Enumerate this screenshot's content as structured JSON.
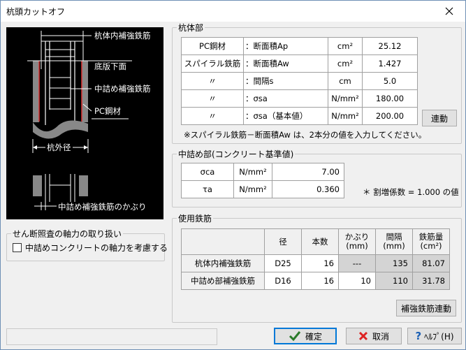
{
  "window": {
    "title": "杭頭カットオフ"
  },
  "diagram": {
    "labels": {
      "pile_inner_rebar": "杭体内補強鉄筋",
      "slab_bottom": "底版下面",
      "filling_rebar": "中詰め補強鉄筋",
      "pc_steel": "PC鋼材",
      "pile_outer_diameter": "杭外径",
      "cover": "中詰め補強鉄筋のかぶり"
    }
  },
  "shear": {
    "legend": "せん断照査の軸力の取り扱い",
    "checkbox_label": "中詰めコンクリートの軸力を考慮する",
    "checked": false
  },
  "pile": {
    "legend": "杭体部",
    "rows": [
      {
        "name": "PC鋼材",
        "item": "：断面積Ap",
        "unit": "cm²",
        "value": "25.12"
      },
      {
        "name": "スパイラル鉄筋",
        "item": "：断面積Aw",
        "unit": "cm²",
        "value": "1.427"
      },
      {
        "name": "〃",
        "item": "：間隔s",
        "unit": "cm",
        "value": "5.0"
      },
      {
        "name": "〃",
        "item": "：σsa",
        "unit": "N/mm²",
        "value": "180.00"
      },
      {
        "name": "〃",
        "item": "：σsa（基本値）",
        "unit": "N/mm²",
        "value": "200.00"
      }
    ],
    "link_button": "連動",
    "note": "※スパイラル鉄筋－断面積Aw は、2本分の値を入力してください。"
  },
  "filling": {
    "legend": "中詰め部(コンクリート基準値)",
    "rows": [
      {
        "name": "σca",
        "unit": "N/mm²",
        "value": "7.00"
      },
      {
        "name": "τa",
        "unit": "N/mm²",
        "value": "0.360"
      }
    ],
    "note": "＊ 割増係数 = 1.000 の値"
  },
  "rebar": {
    "legend": "使用鉄筋",
    "headers": {
      "diameter": "径",
      "count": "本数",
      "cover": "かぶり\n(mm)",
      "spacing": "間隔\n(mm)",
      "amount": "鉄筋量\n(cm²)"
    },
    "rows": [
      {
        "name": "杭体内補強鉄筋",
        "diameter": "D25",
        "count": "16",
        "cover": "---",
        "spacing": "135",
        "amount": "81.07"
      },
      {
        "name": "中詰め部補強鉄筋",
        "diameter": "D16",
        "count": "16",
        "cover": "10",
        "spacing": "110",
        "amount": "31.78"
      }
    ],
    "link_button": "補強鉄筋連動"
  },
  "footer": {
    "ok": "確定",
    "cancel": "取消",
    "help": "ﾍﾙﾌﾟ(H)"
  }
}
